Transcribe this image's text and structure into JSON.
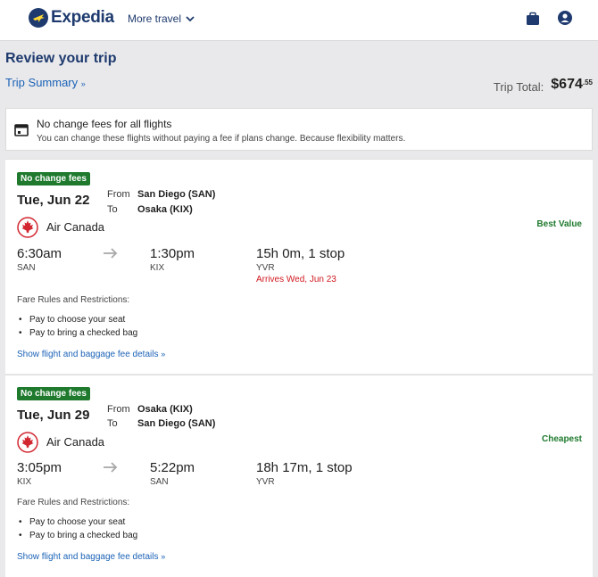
{
  "header": {
    "brand": "Expedia",
    "more_travel": "More travel"
  },
  "page": {
    "title": "Review your trip",
    "trip_summary": "Trip Summary",
    "trip_total_label": "Trip Total:",
    "trip_total_amount": "$674",
    "trip_total_cents": ".55"
  },
  "banner": {
    "title": "No change fees for all flights",
    "text": "You can change these flights without paying a fee if plans change. Because flexibility matters."
  },
  "flights": [
    {
      "badge": "No change fees",
      "date": "Tue, Jun 22",
      "from_label": "From",
      "from": "San Diego (SAN)",
      "to_label": "To",
      "to": "Osaka (KIX)",
      "airline": "Air Canada",
      "tag": "Best Value",
      "depart_time": "6:30am",
      "depart_code": "SAN",
      "arrive_time": "1:30pm",
      "arrive_code": "KIX",
      "duration": "15h 0m, 1 stop",
      "via": "YVR",
      "arrives_note": "Arrives Wed, Jun 23",
      "fare_title": "Fare Rules and Restrictions:",
      "rules": [
        "Pay to choose your seat",
        "Pay to bring a checked bag"
      ],
      "details_link": "Show flight and baggage fee details"
    },
    {
      "badge": "No change fees",
      "date": "Tue, Jun 29",
      "from_label": "From",
      "from": "Osaka (KIX)",
      "to_label": "To",
      "to": "San Diego (SAN)",
      "airline": "Air Canada",
      "tag": "Cheapest",
      "depart_time": "3:05pm",
      "depart_code": "KIX",
      "arrive_time": "5:22pm",
      "arrive_code": "SAN",
      "duration": "18h 17m, 1 stop",
      "via": "YVR",
      "fare_title": "Fare Rules and Restrictions:",
      "rules": [
        "Pay to choose your seat",
        "Pay to bring a checked bag"
      ],
      "details_link": "Show flight and baggage fee details"
    }
  ],
  "icons": {
    "logo": "expedia-plane-logo",
    "trips": "briefcase-icon",
    "account": "account-icon",
    "banner": "calendar-icon",
    "airline": "air-canada-maple-leaf-logo",
    "arrow": "arrow-right-icon"
  },
  "colors": {
    "brand": "#1e3a6e",
    "link": "#1b62b7",
    "badge": "#1f7a2e",
    "alert": "#d0191f",
    "airline": "#d22630"
  }
}
